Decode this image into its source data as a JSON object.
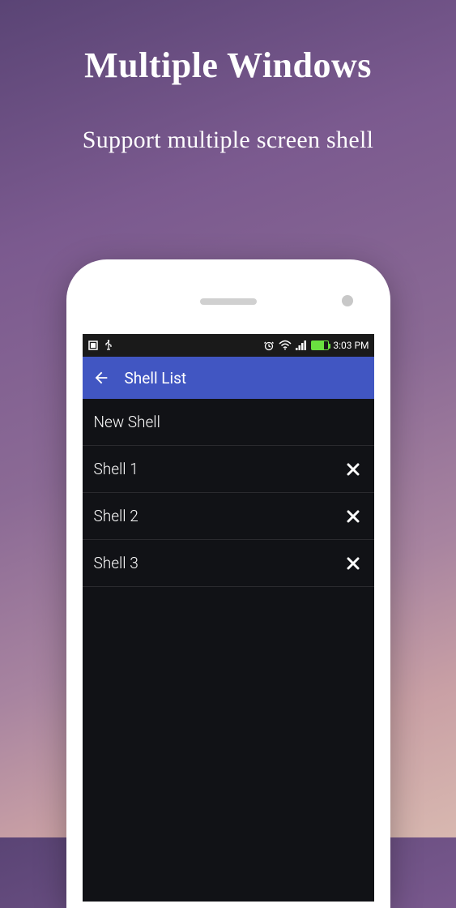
{
  "promo": {
    "title": "Multiple Windows",
    "subtitle": "Support multiple screen shell"
  },
  "statusbar": {
    "time": "3:03 PM"
  },
  "appbar": {
    "title": "Shell List"
  },
  "list": {
    "newShell": "New Shell",
    "items": [
      {
        "label": "Shell 1"
      },
      {
        "label": "Shell 2"
      },
      {
        "label": "Shell 3"
      }
    ]
  }
}
